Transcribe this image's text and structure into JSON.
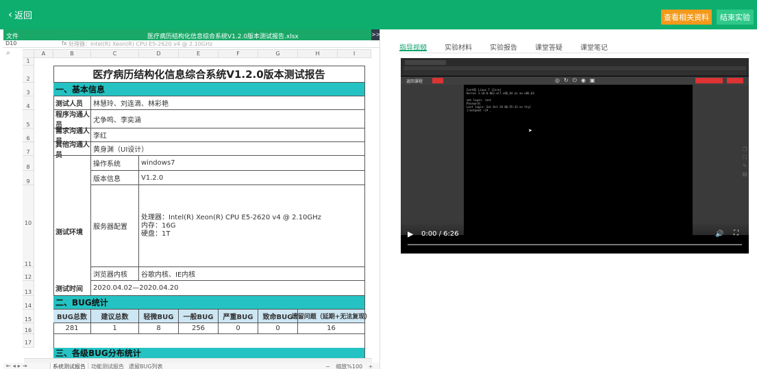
{
  "topbar": {
    "back_label": "返回",
    "related_label": "查看相关资料",
    "end_label": "结束实验"
  },
  "sheet": {
    "menu_label": "文件",
    "file_name": "医疗病历结构化信息综合系统V1.2.0版本测试报告.xlsx",
    "collapse_label": ">>",
    "cell_ref": "D10",
    "fx_label": "fx",
    "formula_value": "处理器：Intel(R) Xeon(R) CPU E5-2620 v4 @ 2.10GHz",
    "columns": [
      "A",
      "B",
      "C",
      "D",
      "E",
      "F",
      "G",
      "H",
      "I"
    ],
    "rows": [
      "1",
      "2",
      "3",
      "4",
      "5",
      "6",
      "7",
      "8",
      "9",
      "10",
      "11",
      "12",
      "13",
      "14",
      "15",
      "16",
      "17"
    ],
    "title": "医疗病历结构化信息综合系统V1.2.0版本测试报告",
    "section1": "一、基本信息",
    "tester_label": "测试人员",
    "tester_value": "林慧玲、刘连滴、林彩艳",
    "prog_contact_label": "程序沟通人员",
    "prog_contact_value": "尤争鸣、李奕涵",
    "req_contact_label": "需求沟通人员",
    "req_contact_value": "李红",
    "other_contact_label": "其他沟通人员",
    "other_contact_value": "黄身渊（UI设计）",
    "env_label": "测试环境",
    "os_label": "操作系统",
    "os_value": "windows7",
    "version_label": "版本信息",
    "version_value": "V1.2.0",
    "server_label": "服务器配置",
    "server_cpu": "处理器：Intel(R) Xeon(R) CPU E5-2620 v4 @ 2.10GHz",
    "server_mem": "内存：16G",
    "server_disk": "硬盘：1T",
    "browser_label": "浏览器内核",
    "browser_value": "谷歌内核、IE内核",
    "time_label": "测试时间",
    "time_value": "2020.04.02—2020.04.20",
    "section2": "二、BUG统计",
    "bug_headers": [
      "BUG总数",
      "建议总数",
      "轻微BUG",
      "一般BUG",
      "严重BUG",
      "致命BUG",
      "遗留问题（延期+无法复现）"
    ],
    "bug_values": [
      "281",
      "1",
      "8",
      "256",
      "0",
      "0",
      "16"
    ],
    "section3": "三、各级BUG分布统计",
    "tabs": [
      "系统测试报告",
      "功能测试报告",
      "遗留BUG列表"
    ],
    "zoom_label": "缩放%100",
    "zoom_minus": "−",
    "zoom_plus": "+"
  },
  "right": {
    "tabs": [
      "指导视频",
      "实验材料",
      "实验报告",
      "课堂答疑",
      "课堂笔记"
    ],
    "video_time": "0:00 / 6:26",
    "video_exit": "返回课程",
    "terminal_text": "CentOS Linux 7 (Core)\nKernel 3.10.0-862.el7.x86_64 on an x86_64\n\nsmt login: root\nPassword:\nLast login: Sat Oct 26 06:55:33 on tty1\n[root@smt ~]# _"
  },
  "colors": {
    "accent": "#0eae6f",
    "orange": "#f39a1c",
    "section_fill": "#24c2c2",
    "header_fill": "#cde6f3"
  }
}
